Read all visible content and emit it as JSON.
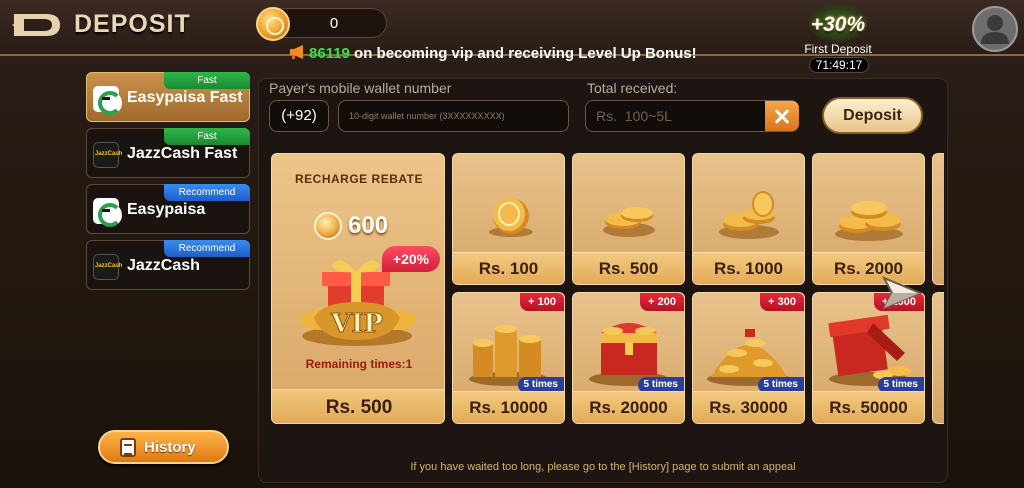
{
  "header": {
    "title": "DEPOSIT",
    "balance": "0",
    "marquee_id": "86119",
    "marquee_text": " on becoming vip and receiving Level Up Bonus!",
    "first_deposit": {
      "bonus_percent": "+30%",
      "label": "First Deposit",
      "countdown": "71:49:17"
    }
  },
  "methods": [
    {
      "label": "Easypaisa Fast",
      "tag": "Fast",
      "logo": "easypaisa-logo",
      "active": true
    },
    {
      "label": "JazzCash Fast",
      "tag": "Fast",
      "logo": "jazzcash-logo",
      "active": false
    },
    {
      "label": "Easypaisa",
      "tag": "Recommend",
      "logo": "easypaisa-logo",
      "active": false
    },
    {
      "label": "JazzCash",
      "tag": "Recommend",
      "logo": "jazzcash-logo",
      "active": false
    }
  ],
  "history_label": "History",
  "form": {
    "wallet_label": "Payer's mobile wallet number",
    "country_code": "(+92)",
    "wallet_placeholder": "10-digit wallet number (3XXXXXXXXX)",
    "amount_label": "Total received:",
    "amount_placeholder": "Rs.  100~5L",
    "deposit_label": "Deposit"
  },
  "rebate": {
    "title": "RECHARGE REBATE",
    "coins": "600",
    "bonus": "+20%",
    "vip_text": "VIP",
    "remaining": "Remaining times:1",
    "price": "Rs. 500"
  },
  "amounts": [
    {
      "price": "Rs. 100",
      "bonus": "",
      "times": "",
      "art": "single-coin"
    },
    {
      "price": "Rs. 500",
      "bonus": "",
      "times": "",
      "art": "small-coin-stack"
    },
    {
      "price": "Rs. 1000",
      "bonus": "",
      "times": "",
      "art": "coin-stack"
    },
    {
      "price": "Rs. 2000",
      "bonus": "",
      "times": "",
      "art": "coin-pile"
    },
    {
      "price": "Rs. 10000",
      "bonus": "+ 100",
      "times": "5 times",
      "art": "coin-heap"
    },
    {
      "price": "Rs. 20000",
      "bonus": "+ 200",
      "times": "5 times",
      "art": "treasure-chest"
    },
    {
      "price": "Rs. 30000",
      "bonus": "+ 300",
      "times": "5 times",
      "art": "coin-mountain"
    },
    {
      "price": "Rs. 50000",
      "bonus": "+ 1000",
      "times": "5 times",
      "art": "gift-box"
    }
  ],
  "footer_note": "If you have waited too long, please go to the [History] page to submit an appeal",
  "colors": {
    "accent_gold": "#e8c38c",
    "tag_fast": "#2fb64a",
    "tag_recommend": "#3a8bf0",
    "bonus_red": "#e8283a",
    "times_blue": "#2a3f9c",
    "marquee_green": "#3bdc4b"
  }
}
